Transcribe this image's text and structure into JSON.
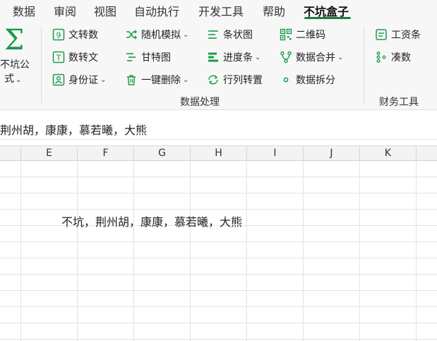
{
  "menu": {
    "tabs": [
      {
        "label": "数据"
      },
      {
        "label": "审阅"
      },
      {
        "label": "视图"
      },
      {
        "label": "自动执行"
      },
      {
        "label": "开发工具"
      },
      {
        "label": "帮助"
      },
      {
        "label": "不坑盒子",
        "active": true
      }
    ]
  },
  "ribbon": {
    "formula_button": {
      "line1": "不坑公",
      "line2": "式",
      "icon": "sigma-icon"
    },
    "tools": {
      "text_to_number": "文转数",
      "number_to_text": "数转文",
      "id_card": "身份证",
      "random_sim": "随机模拟",
      "gantt": "甘特图",
      "one_click_delete": "一键删除",
      "bar_chart": "条状图",
      "progress_bar": "进度条",
      "transpose": "行列转置",
      "qrcode": "二维码",
      "data_merge": "数据合并",
      "data_split": "数据拆分",
      "salary": "工资条",
      "round_sum": "凑数"
    },
    "groups": {
      "data_processing": "数据处理",
      "finance_tools": "财务工具"
    },
    "accent_color": "#1a9a4a"
  },
  "formula_bar": {
    "value": "荆州胡，康康，慕若曦，大熊"
  },
  "sheet": {
    "columns": [
      "E",
      "F",
      "G",
      "H",
      "I",
      "J",
      "K"
    ],
    "cell_value": "不坑，荆州胡，康康，慕若曦，大熊"
  }
}
